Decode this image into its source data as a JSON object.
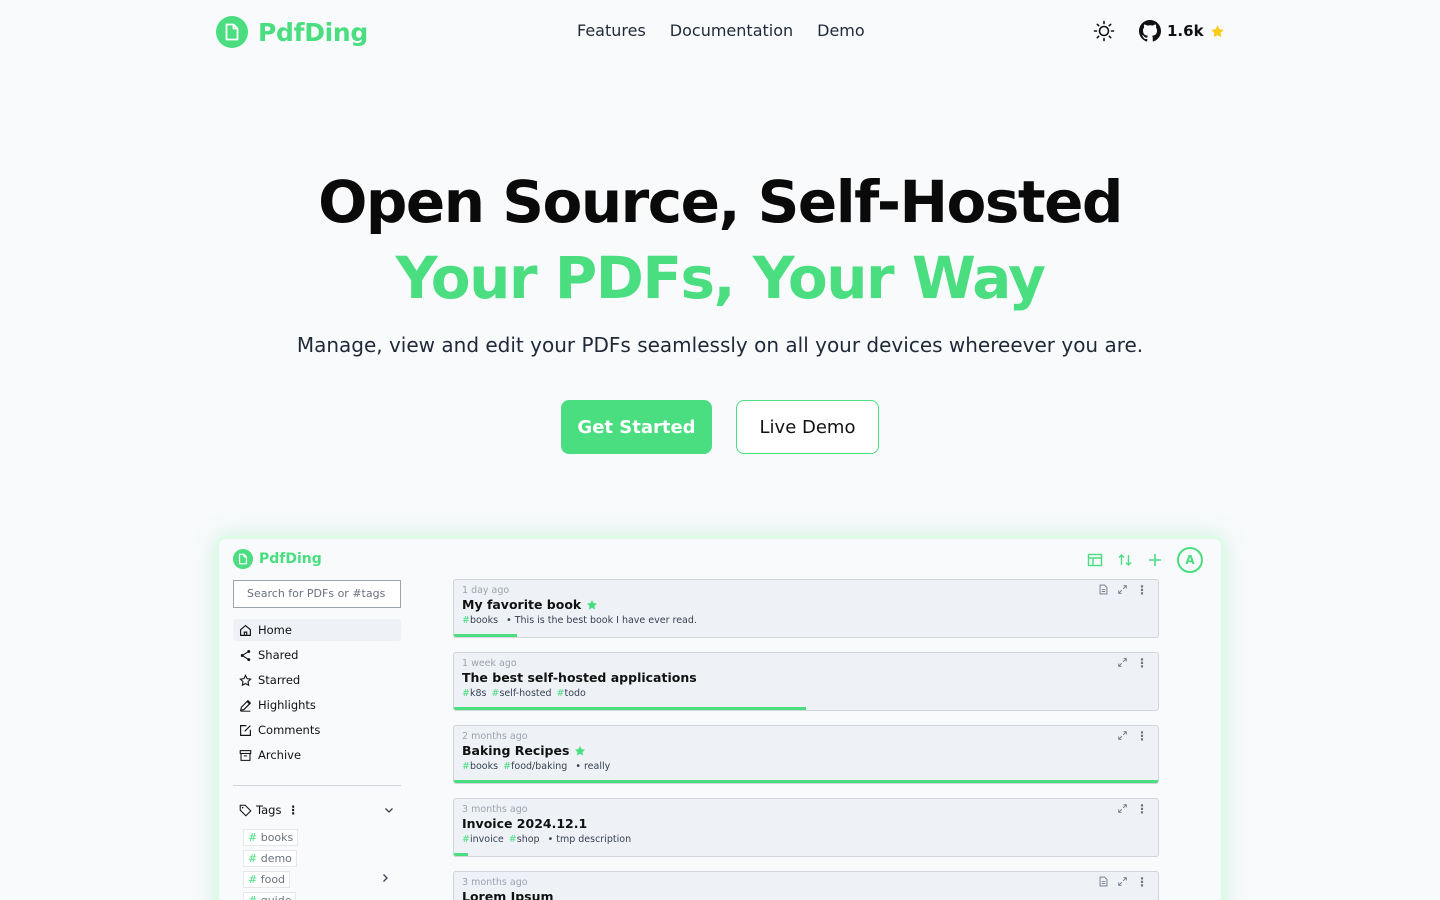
{
  "nav": {
    "brand": "PdfDing",
    "links": [
      "Features",
      "Documentation",
      "Demo"
    ],
    "github_stars": "1.6k"
  },
  "hero": {
    "title_line1": "Open Source, Self-Hosted",
    "title_line2": "Your PDFs, Your Way",
    "subtitle": "Manage, view and edit your PDFs seamlessly on all your devices whereever you are.",
    "cta_primary": "Get Started",
    "cta_secondary": "Live Demo"
  },
  "app": {
    "brand": "PdfDing",
    "avatar_letter": "A",
    "search_placeholder": "Search for PDFs or #tags",
    "menu": [
      "Home",
      "Shared",
      "Starred",
      "Highlights",
      "Comments",
      "Archive"
    ],
    "tags_label": "Tags",
    "tags": [
      "books",
      "demo",
      "food",
      "guide"
    ],
    "pdfs": [
      {
        "time": "1 day ago",
        "title": "My favorite book",
        "starred": true,
        "tags": [
          "books"
        ],
        "desc": "This is the best book I have ever read.",
        "progress": 0.09
      },
      {
        "time": "1 week ago",
        "title": "The best self-hosted applications",
        "starred": false,
        "tags": [
          "k8s",
          "self-hosted",
          "todo"
        ],
        "desc": "",
        "progress": 0.5
      },
      {
        "time": "2 months ago",
        "title": "Baking Recipes",
        "starred": true,
        "tags": [
          "books",
          "food/baking"
        ],
        "desc": "really",
        "progress": 1.0
      },
      {
        "time": "3 months ago",
        "title": "Invoice 2024.12.1",
        "starred": false,
        "tags": [
          "invoice",
          "shop"
        ],
        "desc": "tmp description",
        "progress": 0.02
      },
      {
        "time": "3 months ago",
        "title": "Lorem Ipsum",
        "starred": false,
        "tags": [],
        "desc": "",
        "progress": 0
      }
    ]
  }
}
